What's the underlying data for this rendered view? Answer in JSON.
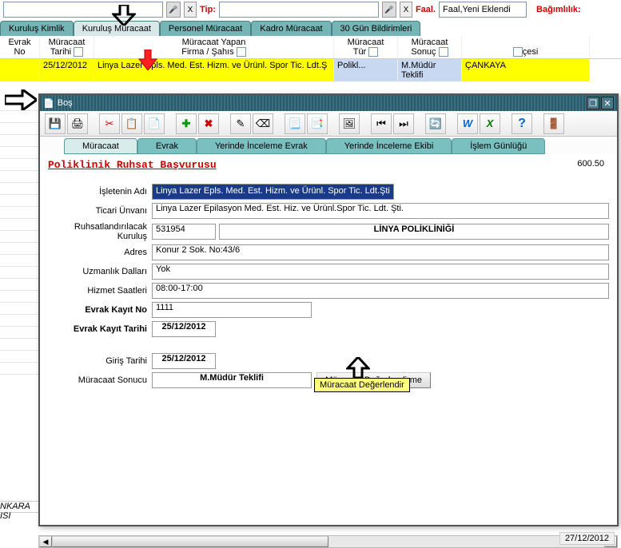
{
  "topbar": {
    "input1": "",
    "tip_label": "Tip:",
    "input2": "",
    "faal_label": "Faal.",
    "faal_value": "Faal,Yeni Eklendi",
    "bagimlilik_label": "Bağımlılık:"
  },
  "top_tabs": [
    "Kuruluş Kimlik",
    "Kuruluş Müracaat",
    "Personel Müracaat",
    "Kadro Müracaat",
    "30 Gün Bildirimleri"
  ],
  "active_top_tab": 1,
  "grid_header": {
    "col1a": "Evrak",
    "col1b": "No",
    "col2a": "Müracaat",
    "col2b": "Tarihi",
    "col3a": "Müracaat Yapan",
    "col3b": "Firma / Şahıs",
    "col4a": "Müracaat",
    "col4b": "Tür",
    "col5a": "Müracaat",
    "col5b": "Sonuç",
    "col6": "çesi"
  },
  "grid_row": {
    "tarih": "25/12/2012",
    "firma": "Linya Lazer Epls. Med. Est. Hizm. ve Ürünl. Spor Tic. Ldt.Ş",
    "tur": "Polikl...",
    "sonuc": "M.Müdür Teklifi",
    "ilce": "ÇANKAYA"
  },
  "window": {
    "title": "Boş",
    "inner_tabs": [
      "Müracaat",
      "Evrak",
      "Yerinde İnceleme Evrak",
      "Yerinde İnceleme Ekibi",
      "İşlem Günlüğü"
    ],
    "active_inner_tab": 0,
    "form_title": "Poliklinik Ruhsat Başvurusu",
    "form_num": "600.50",
    "labels": {
      "isletenin_adi": "İşletenin Adı",
      "ticari_unvani": "Ticari Ünvanı",
      "ruhsatlandirilacak": "Ruhsatlandırılacak Kuruluş",
      "adres": "Adres",
      "uzmanlik": "Uzmanlık Dalları",
      "hizmet": "Hizmet Saatleri",
      "evrak_no": "Evrak Kayıt No",
      "evrak_tarih": "Evrak Kayıt Tarihi",
      "giris_tarih": "Giriş Tarihi",
      "muracaat_sonuc": "Müracaat Sonucu"
    },
    "values": {
      "isletenin_adi": "Linya Lazer Epls. Med. Est. Hizm. ve Ürünl. Spor Tic. Ldt.Şti",
      "ticari_unvani": "Linya Lazer Epilasyon Med. Est. Hiz. ve Ürünl.Spor Tic. Ldt. Şti.",
      "ruhsat_kod": "531954",
      "ruhsat_ad": "LİNYA POLİKLİNİĞİ",
      "adres": "Konur 2 Sok. No:43/6",
      "uzmanlik": "Yok",
      "hizmet": "08:00-17:00",
      "evrak_no": "1111",
      "evrak_tarih": "25/12/2012",
      "giris_tarih": "25/12/2012",
      "muracaat_sonuc": "M.Müdür Teklifi",
      "eval_btn": "Müracaat Değerlendirme"
    },
    "tooltip": "Müracaat Değerlendir"
  },
  "bottom_left": "NKARA ISI",
  "status_date": "27/12/2012"
}
